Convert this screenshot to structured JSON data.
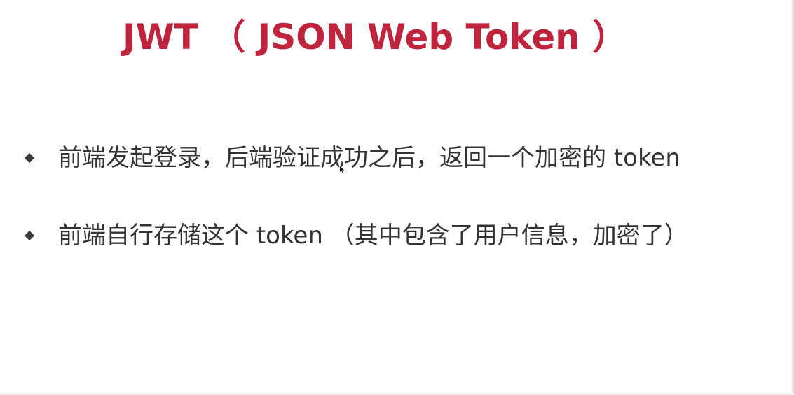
{
  "slide": {
    "title": "JWT （ JSON Web Token ）",
    "bullets": [
      {
        "text": "前端发起登录，后端验证成功之后，返回一个加密的 token"
      },
      {
        "text": "前端自行存储这个 token （其中包含了用户信息，加密了）"
      }
    ]
  },
  "icons": {
    "bullet": "diamond-bullet-icon",
    "cursor": "mouse-pointer-icon"
  },
  "colors": {
    "title": "#c0233c",
    "text": "#333333",
    "bullet": "#3a3a3a",
    "background": "#ffffff"
  }
}
